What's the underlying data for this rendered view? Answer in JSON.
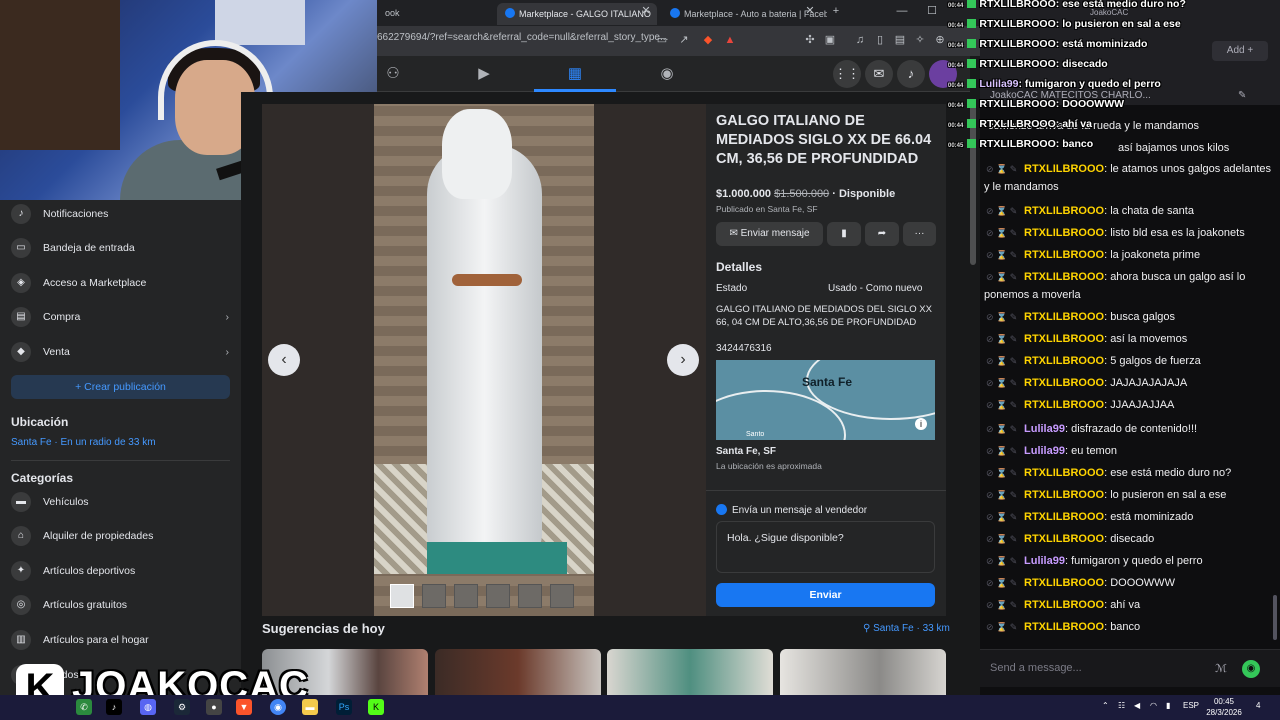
{
  "browser": {
    "tabs": [
      {
        "label": "ook"
      },
      {
        "label": "Marketplace - GALGO ITALIANO",
        "close": "✕"
      },
      {
        "label": "Marketplace - Auto a bateria | Facebo",
        "close": "✕"
      },
      {
        "label": "+"
      }
    ],
    "url": "662279694/?ref=search&referral_code=null&referral_story_type..."
  },
  "sidebar": {
    "items": [
      {
        "label": "Notificaciones",
        "icon": "bell-icon"
      },
      {
        "label": "Bandeja de entrada",
        "icon": "inbox-icon"
      },
      {
        "label": "Acceso a Marketplace",
        "icon": "shield-icon"
      },
      {
        "label": "Compra",
        "icon": "bag-icon",
        "chevron": "›"
      },
      {
        "label": "Venta",
        "icon": "tag-icon",
        "chevron": "›"
      }
    ],
    "create_button": "+ Crear publicación",
    "location_heading": "Ubicación",
    "location_value": "Santa Fe · En un radio de 33 km",
    "categories_heading": "Categorías",
    "categories": [
      {
        "label": "Vehículos",
        "icon": "car-icon"
      },
      {
        "label": "Alquiler de propiedades",
        "icon": "house-icon"
      },
      {
        "label": "Artículos deportivos",
        "icon": "running-icon"
      },
      {
        "label": "Artículos gratuitos",
        "icon": "gift-icon"
      },
      {
        "label": "Artículos para el hogar",
        "icon": "home-goods-icon"
      }
    ],
    "partial_item": "ificados"
  },
  "listing": {
    "title": "GALGO ITALIANO DE MEDIADOS SIGLO XX DE 66.04 CM, 36,56 DE PROFUNDIDAD",
    "price": "$1.000.000",
    "old_price": "$1.500.000",
    "availability": "· Disponible",
    "published": "Publicado en Santa Fe, SF",
    "send_message_button": "Enviar mensaje",
    "more_button": "···",
    "details_heading": "Detalles",
    "condition_label": "Estado",
    "condition_value": "Usado - Como nuevo",
    "description": "GALGO ITALIANO DE MEDIADOS DEL SIGLO XX 66, 04 CM DE ALTO,36,56 DE PROFUNDIDAD",
    "phone": "3424476316",
    "map_city": "Santa Fe",
    "map_small": "Santo",
    "location": "Santa Fe, SF",
    "location_note": "La ubicación es aproximada",
    "message_heading": "Envía un mensaje al vendedor",
    "message_text": "Hola. ¿Sigue disponible?",
    "send_button": "Enviar"
  },
  "suggestions": {
    "title": "Sugerencias de hoy",
    "location": "Santa Fe · 33 km"
  },
  "chat": {
    "header_name": "JoakoCAC",
    "add_button": "Add +",
    "tabs": "JoakoCAC   MATECITOS   CHARLO...",
    "partial_lines": [
      "comenzó arriva de la rueda y le mandamos",
      "así bajamos unos kilos"
    ],
    "messages": [
      {
        "user": "RTXLILBROOO",
        "text": "le atamos unos galgos adelantes y le mandamos",
        "color": "#ffd400"
      },
      {
        "user": "RTXLILBROOO",
        "text": "la chata de santa",
        "color": "#ffd400"
      },
      {
        "user": "RTXLILBROOO",
        "text": "listo bld esa es la joakonets",
        "color": "#ffd400"
      },
      {
        "user": "RTXLILBROOO",
        "text": "la joakoneta prime",
        "color": "#ffd400"
      },
      {
        "user": "RTXLILBROOO",
        "text": "ahora busca un galgo así lo ponemos a moverla",
        "color": "#ffd400"
      },
      {
        "user": "RTXLILBROOO",
        "text": "busca galgos",
        "color": "#ffd400"
      },
      {
        "user": "RTXLILBROOO",
        "text": "así la movemos",
        "color": "#ffd400"
      },
      {
        "user": "RTXLILBROOO",
        "text": "5 galgos de fuerza",
        "color": "#ffd400"
      },
      {
        "user": "RTXLILBROOO",
        "text": "JAJAJAJAJAJA",
        "color": "#ffd400"
      },
      {
        "user": "RTXLILBROOO",
        "text": "JJAAJAJJAA",
        "color": "#ffd400"
      },
      {
        "user": "Lulila99",
        "text": "disfrazado de contenido!!!",
        "color": "#c79bff"
      },
      {
        "user": "Lulila99",
        "text": "eu temon",
        "color": "#c79bff"
      },
      {
        "user": "RTXLILBROOO",
        "text": "ese está medio duro no?",
        "color": "#ffd400"
      },
      {
        "user": "RTXLILBROOO",
        "text": "lo pusieron en sal a ese",
        "color": "#ffd400"
      },
      {
        "user": "RTXLILBROOO",
        "text": "está mominizado",
        "color": "#ffd400"
      },
      {
        "user": "RTXLILBROOO",
        "text": "disecado",
        "color": "#ffd400"
      },
      {
        "user": "Lulila99",
        "text": "fumigaron y quedo el perro",
        "color": "#c79bff"
      },
      {
        "user": "RTXLILBROOO",
        "text": "DOOOWWW",
        "color": "#ffd400"
      },
      {
        "user": "RTXLILBROOO",
        "text": "ahí va",
        "color": "#ffd400"
      },
      {
        "user": "RTXLILBROOO",
        "text": "banco",
        "color": "#ffd400"
      }
    ],
    "input_placeholder": "Send a message..."
  },
  "overlay_chat": [
    {
      "user": "RTXLILBROOO",
      "text": ": ese está medio duro no?"
    },
    {
      "user": "RTXLILBROOO",
      "text": ": lo pusieron en sal a ese"
    },
    {
      "user": "RTXLILBROOO",
      "text": ": está mominizado"
    },
    {
      "user": "RTXLILBROOO",
      "text": ": disecado"
    },
    {
      "user": "Lulila99",
      "text": ": fumigaron y quedo el perro"
    },
    {
      "user": "RTXLILBROOO",
      "text": ": DOOOWWW"
    },
    {
      "user": "RTXLILBROOO",
      "text": ": ahí va"
    },
    {
      "user": "RTXLILBROOO",
      "text": ": banco"
    }
  ],
  "overlay_times": [
    "00:44",
    "00:44",
    "00:44",
    "00:44",
    "00:44",
    "00:44",
    "00:44",
    "00:45"
  ],
  "branding": {
    "logo_letter": "K",
    "logo_text": "JOAKOCAC"
  },
  "taskbar": {
    "lang": "ESP",
    "time": "00:45",
    "date": "28/3/2026",
    "notif": "4"
  }
}
